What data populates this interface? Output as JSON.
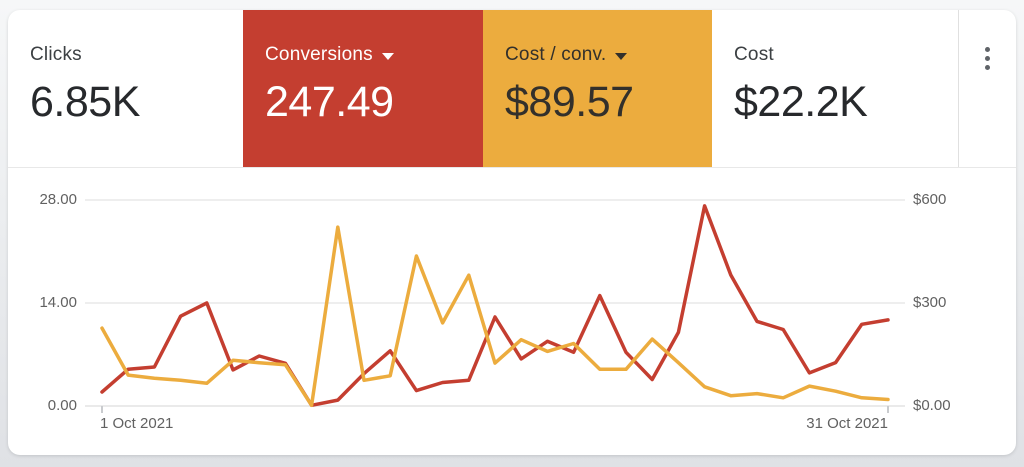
{
  "scorecards": [
    {
      "label": "Clicks",
      "value": "6.85K",
      "variant": "white",
      "has_dropdown": false
    },
    {
      "label": "Conversions",
      "value": "247.49",
      "variant": "red",
      "has_dropdown": true,
      "color": "#C43E30"
    },
    {
      "label": "Cost / conv.",
      "value": "$89.57",
      "variant": "orange",
      "has_dropdown": true,
      "color": "#ECAC3E"
    },
    {
      "label": "Cost",
      "value": "$22.2K",
      "variant": "white",
      "has_dropdown": false
    }
  ],
  "menu": {
    "icon": "kebab-menu-icon"
  },
  "colors": {
    "conversions_red": "#C43E30",
    "cost_per_conv_orange": "#ECAC3E",
    "card_background": "#FFFFFF",
    "axis_text": "#616161",
    "gridline": "#E9E9E9"
  },
  "chart_data": {
    "type": "line",
    "x_unit": "day of October 2021",
    "x": [
      1,
      2,
      3,
      4,
      5,
      6,
      7,
      8,
      9,
      10,
      11,
      12,
      13,
      14,
      15,
      16,
      17,
      18,
      19,
      20,
      21,
      22,
      23,
      24,
      25,
      26,
      27,
      28,
      29,
      30,
      31
    ],
    "series": [
      {
        "name": "Conversions",
        "color": "#C43E30",
        "axis": "left",
        "values": [
          1.9,
          5.0,
          5.3,
          12.2,
          14.0,
          4.9,
          6.8,
          5.8,
          0.1,
          0.8,
          4.4,
          7.5,
          2.1,
          3.2,
          3.5,
          12.1,
          6.4,
          8.8,
          7.3,
          15.0,
          7.3,
          3.6,
          10.0,
          27.2,
          17.8,
          11.5,
          10.4,
          4.5,
          5.9,
          11.1,
          11.7
        ]
      },
      {
        "name": "Cost / conv.",
        "color": "#ECAC3E",
        "axis": "right",
        "values": [
          227,
          90,
          81,
          75,
          66,
          133,
          126,
          120,
          2,
          521,
          75,
          88,
          437,
          242,
          381,
          125,
          193,
          159,
          182,
          107,
          107,
          195,
          126,
          56,
          30,
          36,
          24,
          58,
          43,
          24,
          19
        ]
      }
    ],
    "left_axis": {
      "min": 0,
      "max": 28,
      "ticks": [
        "28.00",
        "14.00",
        "0.00"
      ]
    },
    "right_axis": {
      "min": 0,
      "max": 600,
      "ticks": [
        "$600",
        "$300",
        "$0.00"
      ]
    },
    "x_axis": {
      "first_label": "1 Oct 2021",
      "last_label": "31 Oct 2021"
    },
    "grid": true,
    "legend": "none"
  }
}
